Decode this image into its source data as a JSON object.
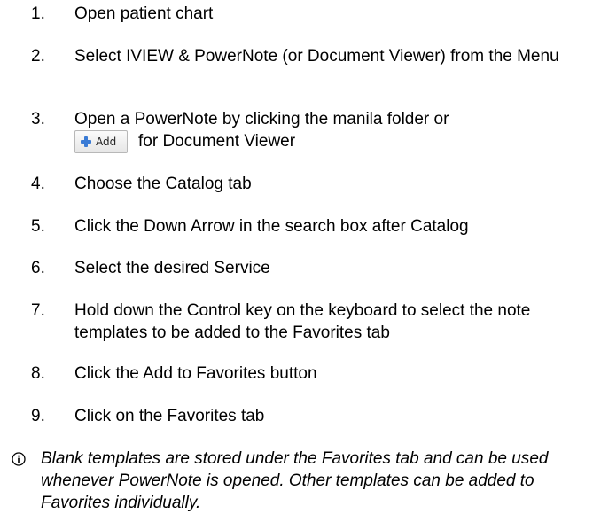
{
  "steps": [
    {
      "number": "1.",
      "text": "Open patient chart"
    },
    {
      "number": "2.",
      "text": "Select IVIEW & PowerNote (or Document Viewer) from the Menu"
    },
    {
      "number": "3.",
      "text_before": "Open a PowerNote by clicking the manila folder or",
      "button_label": "Add",
      "text_after": "for Document Viewer"
    },
    {
      "number": "4.",
      "text": "Choose the Catalog tab"
    },
    {
      "number": "5.",
      "text": "Click the Down Arrow in the search box after Catalog"
    },
    {
      "number": "6.",
      "text": "Select the desired Service"
    },
    {
      "number": "7.",
      "text": "Hold down the Control key on the keyboard to select the note templates to be added to the Favorites tab"
    },
    {
      "number": "8.",
      "text": "Click the Add to Favorites button"
    },
    {
      "number": "9.",
      "text": "Click on the Favorites tab"
    }
  ],
  "note": {
    "icon": "info-icon",
    "text": "Blank templates are stored under the Favorites tab and can be used whenever PowerNote is opened.  Other templates can be added to Favorites individually."
  },
  "colors": {
    "text": "#000000",
    "plus_icon": "#3a7bd5",
    "button_border": "#b8b8b8"
  }
}
